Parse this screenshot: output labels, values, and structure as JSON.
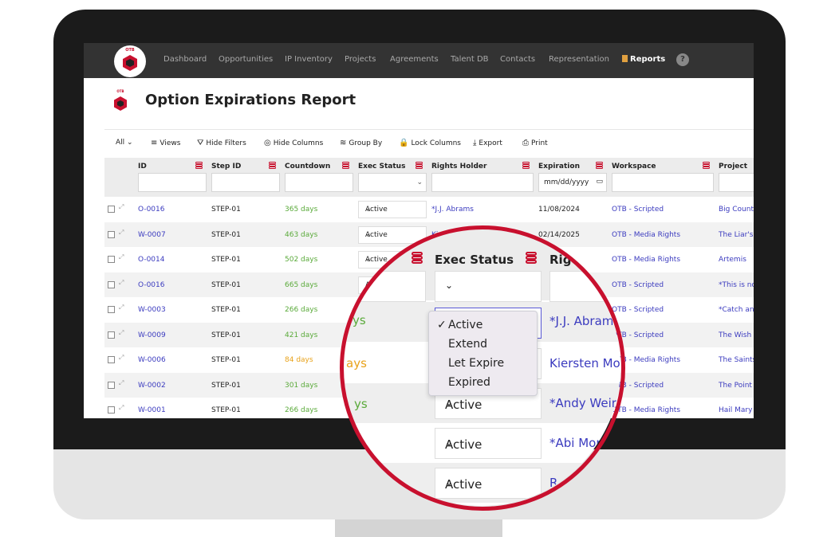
{
  "nav": {
    "logo_text": "OTB",
    "items": [
      "Dashboard",
      "Opportunities",
      "IP Inventory",
      "Projects",
      "Agreements",
      "Talent DB",
      "Contacts",
      "Representation"
    ],
    "reports": "Reports",
    "help": "?"
  },
  "page": {
    "logo_text": "OTB",
    "title": "Option Expirations Report"
  },
  "toolbar": {
    "all": "All",
    "views": "Views",
    "hide_filters": "Hide Filters",
    "hide_columns": "Hide Columns",
    "group_by": "Group By",
    "lock_columns": "Lock Columns",
    "export": "Export",
    "print": "Print"
  },
  "columns": {
    "id": "ID",
    "step_id": "Step ID",
    "countdown": "Countdown",
    "exec_status": "Exec Status",
    "rights_holder": "Rights Holder",
    "expiration": "Expiration",
    "workspace": "Workspace",
    "project": "Project"
  },
  "filters": {
    "expiration_placeholder": "mm/dd/yyyy"
  },
  "rows": [
    {
      "id": "O-0016",
      "step": "STEP-01",
      "countdown": "365 days",
      "status": "Active",
      "holder": "*J.J. Abrams",
      "expiration": "11/08/2024",
      "workspace": "OTB - Scripted",
      "project": "Big Count"
    },
    {
      "id": "W-0007",
      "step": "STEP-01",
      "countdown": "463 days",
      "status": "Active",
      "holder": "Kiersten",
      "expiration": "02/14/2025",
      "workspace": "OTB - Media Rights",
      "project": "The Liar's"
    },
    {
      "id": "O-0014",
      "step": "STEP-01",
      "countdown": "502 days",
      "status": "Active",
      "holder": "",
      "expiration": "025",
      "workspace": "OTB - Media Rights",
      "project": "Artemis"
    },
    {
      "id": "O-0016",
      "step": "STEP-01",
      "countdown": "665 days",
      "status": "Ac",
      "holder": "",
      "expiration": "",
      "workspace": "OTB - Scripted",
      "project": "*This is no"
    },
    {
      "id": "W-0003",
      "step": "STEP-01",
      "countdown": "266 days",
      "status": "",
      "holder": "",
      "expiration": "",
      "workspace": "OTB - Scripted",
      "project": "*Catch an"
    },
    {
      "id": "W-0009",
      "step": "STEP-01",
      "countdown": "421 days",
      "status": "",
      "holder": "",
      "expiration": "",
      "workspace": "OTB - Scripted",
      "project": "The Wish"
    },
    {
      "id": "W-0006",
      "step": "STEP-01",
      "countdown": "84 days",
      "status": "",
      "holder": "",
      "expiration": "",
      "workspace": "OTB - Media Rights",
      "project": "The Saints"
    },
    {
      "id": "W-0002",
      "step": "STEP-01",
      "countdown": "301 days",
      "status": "",
      "holder": "",
      "expiration": "",
      "workspace": "OTB - Scripted",
      "project": "The Point"
    },
    {
      "id": "W-0001",
      "step": "STEP-01",
      "countdown": "266 days",
      "status": "",
      "holder": "",
      "expiration": "",
      "workspace": "OTB - Media Rights",
      "project": "Hail Mary"
    }
  ],
  "magnifier": {
    "header_status": "Exec Status",
    "header_holder": "Rig",
    "header_date": "25",
    "days_fragment": "ys",
    "days_fragment2": "ays",
    "rows": [
      {
        "status": "",
        "holder": "*J.J. Abram"
      },
      {
        "status": "",
        "holder": "Kiersten Mod"
      },
      {
        "status": "Active",
        "holder": "*Andy Weir"
      },
      {
        "status": "Active",
        "holder": "*Abi Mor"
      },
      {
        "status": "Active",
        "holder": "R"
      }
    ],
    "dropdown_options": [
      "Active",
      "Extend",
      "Let Expire",
      "Expired"
    ],
    "dropdown_selected": "Active"
  }
}
